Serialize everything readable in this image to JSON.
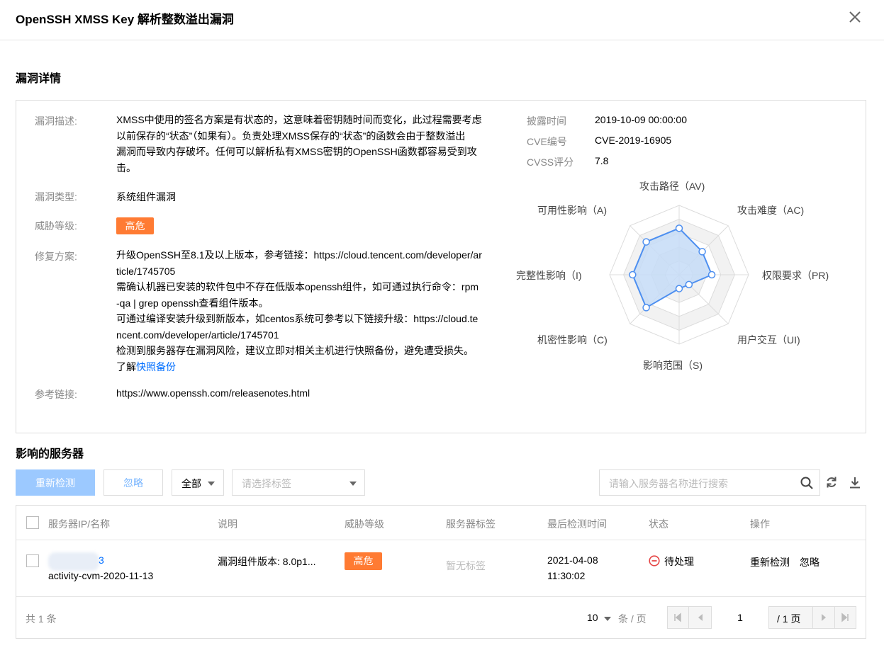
{
  "dialog": {
    "title": "OpenSSH XMSS Key 解析整数溢出漏洞"
  },
  "details": {
    "section_title": "漏洞详情",
    "desc_label": "漏洞描述:",
    "desc_lines": [
      "XMSS中使用的签名方案是有状态的，这意味着密钥随时间而变化，此过程需要考虑",
      "以前保存的“状态”（如果有）。负责处理XMSS保存的“状态”的函数会由于整数溢出",
      "漏洞而导致内存破坏。任何可以解析私有XMSS密钥的OpenSSH函数都容易受到攻",
      "击。"
    ],
    "type_label": "漏洞类型:",
    "type_value": "系统组件漏洞",
    "level_label": "威胁等级:",
    "level_value": "高危",
    "fix_label": "修复方案:",
    "fix_lines": [
      "升级OpenSSH至8.1及以上版本，参考链接：https://cloud.tencent.com/developer/ar",
      "ticle/1745705",
      "需确认机器已安装的软件包中不存在低版本openssh组件，如可通过执行命令：rpm",
      "-qa | grep openssh查看组件版本。",
      "可通过编译安装升级到新版本，如centos系统可参考以下链接升级：https://cloud.te",
      "ncent.com/developer/article/1745701",
      "检测到服务器存在漏洞风险，建议立即对相关主机进行快照备份，避免遭受损失。"
    ],
    "fix_last_prefix": "了解",
    "fix_last_link": "快照备份",
    "ref_label": "参考链接:",
    "ref_value": "https://www.openssh.com/releasenotes.html",
    "disclose_label": "披露时间",
    "disclose_value": "2019-10-09 00:00:00",
    "cve_label": "CVE编号",
    "cve_value": "CVE-2019-16905",
    "cvss_label": "CVSS评分",
    "cvss_value": "7.8"
  },
  "radar": {
    "labels": [
      "攻击路径（AV)",
      "攻击难度（AC)",
      "权限要求（PR)",
      "用户交互（UI)",
      "影响范围（S)",
      "机密性影响（C)",
      "完整性影响（I)",
      "可用性影响（A)"
    ],
    "values": [
      0.67,
      0.47,
      0.47,
      0.2,
      0.2,
      0.67,
      0.67,
      0.67
    ],
    "fill_color": "#c6dcf7",
    "stroke_color": "#4d8ff0"
  },
  "servers": {
    "section_title": "影响的服务器",
    "recheck_button": "重新检测",
    "ignore_button": "忽略",
    "filter_all": "全部",
    "tag_placeholder": "请选择标签",
    "search_placeholder": "请输入服务器名称进行搜索",
    "columns": [
      "服务器IP/名称",
      "说明",
      "威胁等级",
      "服务器标签",
      "最后检测时间",
      "状态",
      "操作"
    ],
    "rows": [
      {
        "ip_suffix": "3",
        "name": "activity-cvm-2020-11-13",
        "desc": "漏洞组件版本: 8.0p1...",
        "level": "高危",
        "tag": "暂无标签",
        "date": "2021-04-08",
        "time": "11:30:02",
        "status": "待处理",
        "action_recheck": "重新检测",
        "action_ignore": "忽略"
      }
    ],
    "total_text": "共 1 条",
    "page_size": "10",
    "page_size_unit": "条 / 页",
    "page_current": "1",
    "page_total": "/ 1 页"
  },
  "colors": {
    "accent": "#006eff",
    "danger": "#ff7b33",
    "status_red": "#e54545"
  }
}
